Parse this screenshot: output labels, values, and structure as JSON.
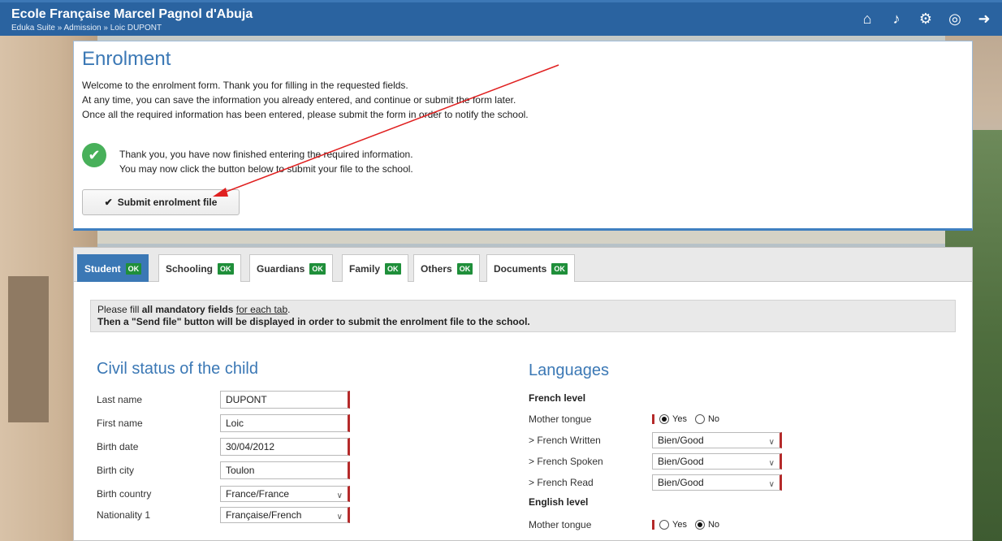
{
  "header": {
    "school_name": "Ecole Française Marcel Pagnol d'Abuja",
    "breadcrumb": "Eduka Suite » Admission » Loic DUPONT",
    "icons": [
      "home-icon",
      "bell-icon",
      "settings-icon",
      "help-icon",
      "logout-icon"
    ]
  },
  "enrolment": {
    "title": "Enrolment",
    "intro_1": "Welcome to the enrolment form. Thank you for filling in the requested fields.",
    "intro_2": "At any time, you can save the information you already entered, and continue or submit the form later.",
    "intro_3": "Once all the required information has been entered, please submit the form in order to notify the school.",
    "thanks_1": "Thank you, you have now finished entering the required information.",
    "thanks_2": "You may now click the button below to submit your file to the school.",
    "submit_label": "Submit enrolment file"
  },
  "tabs": [
    {
      "label": "Student",
      "badge": "OK"
    },
    {
      "label": "Schooling",
      "badge": "OK"
    },
    {
      "label": "Guardians",
      "badge": "OK"
    },
    {
      "label": "Family",
      "badge": "OK"
    },
    {
      "label": "Others",
      "badge": "OK"
    },
    {
      "label": "Documents",
      "badge": "OK"
    }
  ],
  "notice": {
    "pre": "Please fill ",
    "bold": "all mandatory fields",
    "link": "for each tab",
    "post": ".",
    "line2": "Then a \"Send file\" button will be displayed in order to submit the enrolment file to the school."
  },
  "civil": {
    "title": "Civil status of the child",
    "fields": [
      {
        "label": "Last name",
        "value": "DUPONT"
      },
      {
        "label": "First name",
        "value": "Loic"
      },
      {
        "label": "Birth date",
        "value": "30/04/2012"
      },
      {
        "label": "Birth city",
        "value": "Toulon"
      },
      {
        "label": "Birth country",
        "value": "France/France"
      },
      {
        "label": "Nationality 1",
        "value": "Française/French"
      }
    ]
  },
  "languages": {
    "title": "Languages",
    "french_level": "French level",
    "mother_tongue": "Mother tongue",
    "yes": "Yes",
    "no": "No",
    "french_written": "> French Written",
    "french_spoken": "> French Spoken",
    "french_read": "> French Read",
    "written_value": "Bien/Good",
    "spoken_value": "Bien/Good",
    "read_value": "Bien/Good",
    "english_level": "English level",
    "english_mother_tongue": "Mother tongue"
  },
  "colors": {
    "header_blue": "#2a63a0",
    "accent_blue": "#3b78b5",
    "ok_green": "#1f8f3a",
    "required_red": "#b52a2a",
    "annotation_red": "#e02020"
  }
}
